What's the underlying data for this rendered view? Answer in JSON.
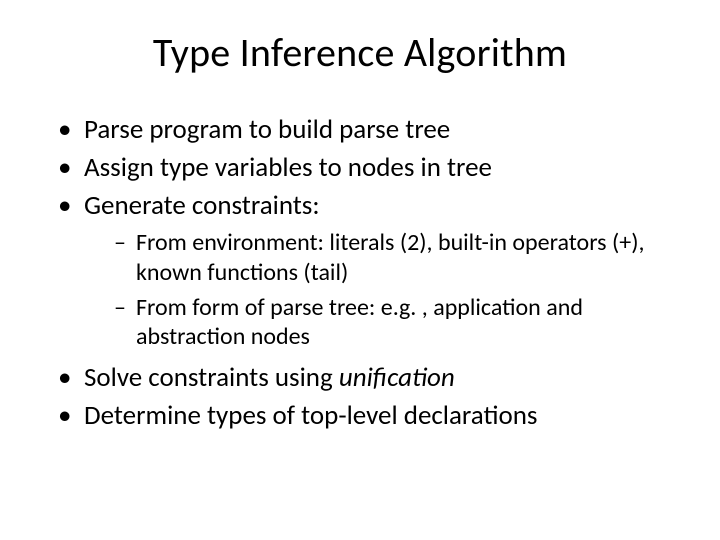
{
  "title": "Type Inference Algorithm",
  "bullets": {
    "b1": "Parse program to build parse tree",
    "b2": "Assign type variables to nodes in tree",
    "b3": "Generate constraints:",
    "b3_sub1": "From environment: literals (2), built-in operators (+), known functions (tail)",
    "b3_sub2": "From form of parse tree: e.g. , application and abstraction nodes",
    "b4_pre": "Solve constraints using ",
    "b4_ital": "unification",
    "b5": "Determine types of top-level declarations"
  }
}
